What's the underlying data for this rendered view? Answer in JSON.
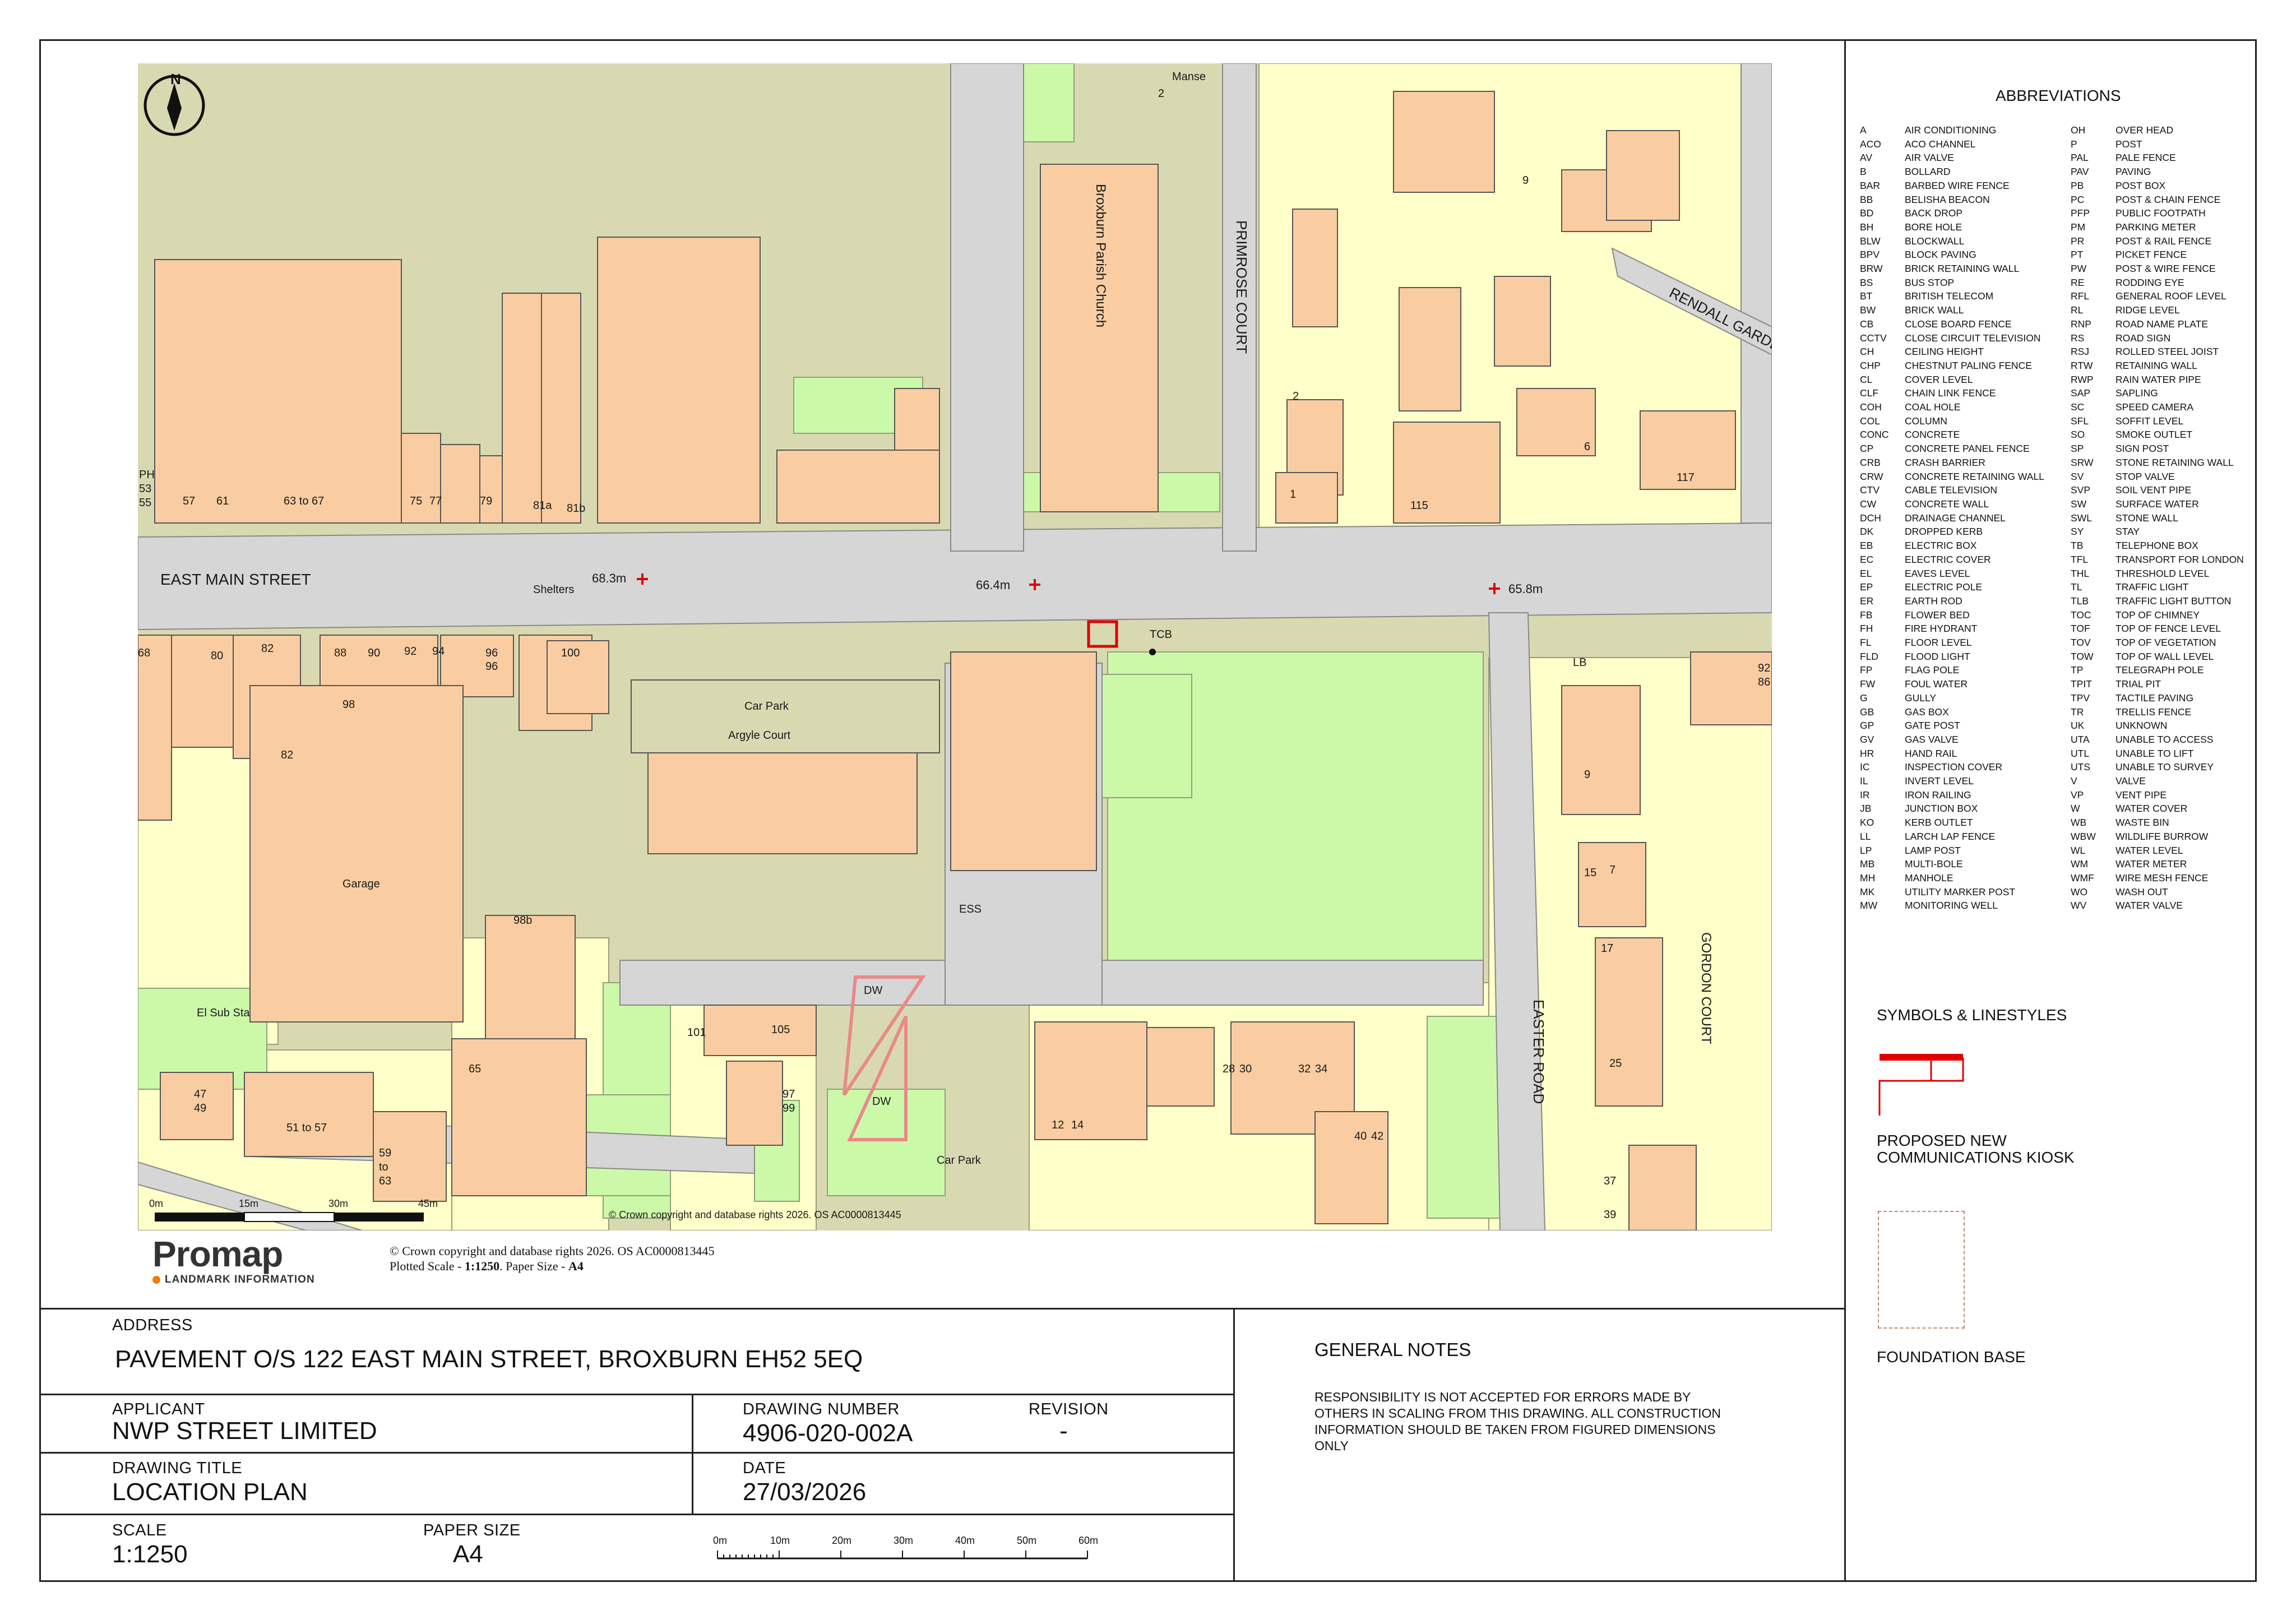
{
  "map": {
    "streets": {
      "east_main_street": "EAST MAIN STREET",
      "primrose_court": "PRIMROSE COURT",
      "rendall_gardens": "RENDALL GARDE",
      "easter_road": "EASTER ROAD",
      "gordon_court": "GORDON COURT"
    },
    "features": {
      "church": "Broxburn Parish Church",
      "manse": "Manse",
      "shelters": "Shelters",
      "car_park_1": "Car Park",
      "argyle_court": "Argyle Court",
      "car_park_2": "Car Park",
      "garage": "Garage",
      "el_sub_sta": "El Sub Sta",
      "ess": "ESS",
      "tcb": "TCB",
      "lb": "LB",
      "dw_1": "DW",
      "dw_2": "DW"
    },
    "spot_heights": {
      "h1": "68.3m",
      "h2": "66.4m",
      "h3": "65.8m"
    },
    "house_numbers": {
      "n_ph": "PH",
      "n_53": "53",
      "n_55": "55",
      "n_57": "57",
      "n_61": "61",
      "n_63_67": "63 to 67",
      "n_75": "75",
      "n_77": "77",
      "n_79": "79",
      "n_81a": "81a",
      "n_81b": "81b",
      "n_2_manse": "2",
      "n_9": "9",
      "n_2": "2",
      "n_1": "1",
      "n_115": "115",
      "n_6": "6",
      "n_117": "117",
      "n_68": "68",
      "n_80": "80",
      "n_82": "82",
      "n_88": "88",
      "n_90": "90",
      "n_92": "92",
      "n_94": "94",
      "n_96": "96",
      "n_98": "98",
      "n_96b": "96",
      "n_100": "100",
      "n_98b": "98",
      "n_82b": "82",
      "n_98b2": "98b",
      "n_9b": "9",
      "n_15": "15",
      "n_7": "7",
      "n_92r": "92",
      "n_86r": "86",
      "n_17": "17",
      "n_25": "25",
      "n_37": "37",
      "n_39": "39",
      "n_101": "101",
      "n_105": "105",
      "n_97": "97",
      "n_99": "99",
      "n_12": "12",
      "n_14": "14",
      "n_28": "28",
      "n_30": "30",
      "n_32": "32",
      "n_34": "34",
      "n_40": "40",
      "n_42": "42",
      "n_47": "47",
      "n_49": "49",
      "n_51_57": "51 to 57",
      "n_59": "59",
      "n_to": "to",
      "n_63": "63",
      "n_65": "65"
    },
    "scale_bar": {
      "ticks": [
        "0m",
        "15m",
        "30m",
        "45m"
      ]
    },
    "copyright_in_map": "© Crown copyright and database rights 2026. OS AC0000813445"
  },
  "promap": {
    "logo": "Promap",
    "sub": "LANDMARK INFORMATION",
    "copyright": "© Crown copyright and database rights 2026. OS AC0000813445",
    "plotted_prefix": "Plotted Scale - ",
    "plotted_scale": "1:1250",
    "paper_prefix": ". Paper Size - ",
    "paper_size": "A4"
  },
  "title_block": {
    "address_label": "ADDRESS",
    "address": "PAVEMENT O/S 122 EAST MAIN STREET, BROXBURN EH52 5EQ",
    "applicant_label": "APPLICANT",
    "applicant": "NWP STREET LIMITED",
    "drawing_number_label": "DRAWING NUMBER",
    "drawing_number": "4906-020-002A",
    "revision_label": "REVISION",
    "revision": "-",
    "drawing_title_label": "DRAWING TITLE",
    "drawing_title": "LOCATION PLAN",
    "date_label": "DATE",
    "date": "27/03/2026",
    "scale_label": "SCALE",
    "scale": "1:1250",
    "paper_size_label": "PAPER SIZE",
    "paper_size": "A4",
    "scale_bar_ticks": [
      "0m",
      "10m",
      "20m",
      "30m",
      "40m",
      "50m",
      "60m"
    ]
  },
  "general_notes": {
    "title": "GENERAL NOTES",
    "lines": [
      "RESPONSIBILITY IS NOT ACCEPTED FOR ERRORS MADE BY",
      "OTHERS IN SCALING FROM THIS DRAWING. ALL CONSTRUCTION",
      "INFORMATION SHOULD BE TAKEN FROM FIGURED DIMENSIONS",
      "ONLY"
    ]
  },
  "abbreviations": {
    "title": "ABBREVIATIONS",
    "left": [
      [
        "A",
        "AIR CONDITIONING"
      ],
      [
        "ACO",
        "ACO CHANNEL"
      ],
      [
        "AV",
        "AIR VALVE"
      ],
      [
        "B",
        "BOLLARD"
      ],
      [
        "BAR",
        "BARBED WIRE FENCE"
      ],
      [
        "BB",
        "BELISHA BEACON"
      ],
      [
        "BD",
        "BACK DROP"
      ],
      [
        "BH",
        "BORE HOLE"
      ],
      [
        "BLW",
        "BLOCKWALL"
      ],
      [
        "BPV",
        "BLOCK PAVING"
      ],
      [
        "BRW",
        "BRICK RETAINING WALL"
      ],
      [
        "BS",
        "BUS STOP"
      ],
      [
        "BT",
        "BRITISH TELECOM"
      ],
      [
        "BW",
        "BRICK WALL"
      ],
      [
        "CB",
        "CLOSE BOARD FENCE"
      ],
      [
        "CCTV",
        "CLOSE CIRCUIT TELEVISION"
      ],
      [
        "CH",
        "CEILING HEIGHT"
      ],
      [
        "CHP",
        "CHESTNUT PALING FENCE"
      ],
      [
        "CL",
        "COVER LEVEL"
      ],
      [
        "CLF",
        "CHAIN LINK FENCE"
      ],
      [
        "COH",
        "COAL HOLE"
      ],
      [
        "COL",
        "COLUMN"
      ],
      [
        "CONC",
        "CONCRETE"
      ],
      [
        "CP",
        "CONCRETE PANEL FENCE"
      ],
      [
        "CRB",
        "CRASH BARRIER"
      ],
      [
        "CRW",
        "CONCRETE RETAINING WALL"
      ],
      [
        "CTV",
        "CABLE TELEVISION"
      ],
      [
        "CW",
        "CONCRETE WALL"
      ],
      [
        "DCH",
        "DRAINAGE CHANNEL"
      ],
      [
        "DK",
        "DROPPED KERB"
      ],
      [
        "EB",
        "ELECTRIC BOX"
      ],
      [
        "EC",
        "ELECTRIC COVER"
      ],
      [
        "EL",
        "EAVES LEVEL"
      ],
      [
        "EP",
        "ELECTRIC POLE"
      ],
      [
        "ER",
        "EARTH ROD"
      ],
      [
        "FB",
        "FLOWER BED"
      ],
      [
        "FH",
        "FIRE HYDRANT"
      ],
      [
        "FL",
        "FLOOR LEVEL"
      ],
      [
        "FLD",
        "FLOOD LIGHT"
      ],
      [
        "FP",
        "FLAG POLE"
      ],
      [
        "FW",
        "FOUL WATER"
      ],
      [
        "G",
        "GULLY"
      ],
      [
        "GB",
        "GAS BOX"
      ],
      [
        "GP",
        "GATE POST"
      ],
      [
        "GV",
        "GAS VALVE"
      ],
      [
        "HR",
        "HAND RAIL"
      ],
      [
        "IC",
        "INSPECTION COVER"
      ],
      [
        "IL",
        "INVERT LEVEL"
      ],
      [
        "IR",
        "IRON RAILING"
      ],
      [
        "JB",
        "JUNCTION BOX"
      ],
      [
        "KO",
        "KERB OUTLET"
      ],
      [
        "LL",
        "LARCH LAP FENCE"
      ],
      [
        "LP",
        "LAMP POST"
      ],
      [
        "MB",
        "MULTI-BOLE"
      ],
      [
        "MH",
        "MANHOLE"
      ],
      [
        "MK",
        "UTILITY MARKER POST"
      ],
      [
        "MW",
        "MONITORING WELL"
      ]
    ],
    "right": [
      [
        "OH",
        "OVER HEAD"
      ],
      [
        "P",
        "POST"
      ],
      [
        "PAL",
        "PALE FENCE"
      ],
      [
        "PAV",
        "PAVING"
      ],
      [
        "PB",
        "POST BOX"
      ],
      [
        "PC",
        "POST & CHAIN FENCE"
      ],
      [
        "PFP",
        "PUBLIC FOOTPATH"
      ],
      [
        "PM",
        "PARKING METER"
      ],
      [
        "PR",
        "POST & RAIL FENCE"
      ],
      [
        "PT",
        "PICKET FENCE"
      ],
      [
        "PW",
        "POST & WIRE FENCE"
      ],
      [
        "RE",
        "RODDING EYE"
      ],
      [
        "RFL",
        "GENERAL ROOF LEVEL"
      ],
      [
        "RL",
        "RIDGE LEVEL"
      ],
      [
        "RNP",
        "ROAD NAME PLATE"
      ],
      [
        "RS",
        "ROAD SIGN"
      ],
      [
        "RSJ",
        "ROLLED STEEL JOIST"
      ],
      [
        "RTW",
        "RETAINING WALL"
      ],
      [
        "RWP",
        "RAIN WATER PIPE"
      ],
      [
        "SAP",
        "SAPLING"
      ],
      [
        "SC",
        "SPEED CAMERA"
      ],
      [
        "SFL",
        "SOFFIT LEVEL"
      ],
      [
        "SO",
        "SMOKE OUTLET"
      ],
      [
        "SP",
        "SIGN POST"
      ],
      [
        "SRW",
        "STONE RETAINING WALL"
      ],
      [
        "SV",
        "STOP VALVE"
      ],
      [
        "SVP",
        "SOIL VENT PIPE"
      ],
      [
        "SW",
        "SURFACE WATER"
      ],
      [
        "SWL",
        "STONE WALL"
      ],
      [
        "SY",
        "STAY"
      ],
      [
        "TB",
        "TELEPHONE BOX"
      ],
      [
        "TFL",
        "TRANSPORT FOR LONDON"
      ],
      [
        "THL",
        "THRESHOLD LEVEL"
      ],
      [
        "TL",
        "TRAFFIC LIGHT"
      ],
      [
        "TLB",
        "TRAFFIC LIGHT BUTTON"
      ],
      [
        "TOC",
        "TOP OF CHIMNEY"
      ],
      [
        "TOF",
        "TOP OF FENCE LEVEL"
      ],
      [
        "TOV",
        "TOP OF VEGETATION"
      ],
      [
        "TOW",
        "TOP OF WALL LEVEL"
      ],
      [
        "TP",
        "TELEGRAPH POLE"
      ],
      [
        "TPIT",
        "TRIAL PIT"
      ],
      [
        "TPV",
        "TACTILE PAVING"
      ],
      [
        "TR",
        "TRELLIS FENCE"
      ],
      [
        "UK",
        "UNKNOWN"
      ],
      [
        "UTA",
        "UNABLE TO ACCESS"
      ],
      [
        "UTL",
        "UNABLE TO LIFT"
      ],
      [
        "UTS",
        "UNABLE TO SURVEY"
      ],
      [
        "V",
        "VALVE"
      ],
      [
        "VP",
        "VENT PIPE"
      ],
      [
        "W",
        "WATER COVER"
      ],
      [
        "WB",
        "WASTE BIN"
      ],
      [
        "WBW",
        "WILDLIFE BURROW"
      ],
      [
        "WL",
        "WATER LEVEL"
      ],
      [
        "WM",
        "WATER METER"
      ],
      [
        "WMF",
        "WIRE MESH FENCE"
      ],
      [
        "WO",
        "WASH OUT"
      ],
      [
        "WV",
        "WATER VALVE"
      ]
    ]
  },
  "symbols": {
    "title": "SYMBOLS & LINESTYLES",
    "kiosk_line1": "PROPOSED NEW",
    "kiosk_line2": "COMMUNICATIONS KIOSK",
    "foundation": "FOUNDATION BASE"
  },
  "colors": {
    "building": "#f9cda1",
    "parcel": "#d9d9b1",
    "yellow_land": "#ffffc9",
    "green_land": "#ccf9a8",
    "road": "#d6d6d6",
    "kiosk_red": "#e00000"
  }
}
